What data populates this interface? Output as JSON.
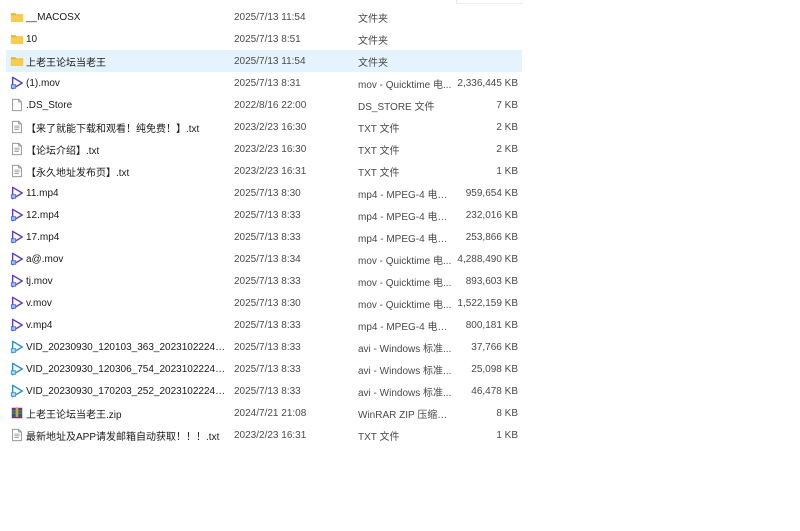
{
  "files": [
    {
      "name": "__MACOSX",
      "date": "2025/7/13 11:54",
      "type": "文件夹",
      "size": "",
      "icon": "folder-icon"
    },
    {
      "name": "10",
      "date": "2025/7/13 8:51",
      "type": "文件夹",
      "size": "",
      "icon": "folder-icon"
    },
    {
      "name": "上老王论坛当老王",
      "date": "2025/7/13 11:54",
      "type": "文件夹",
      "size": "",
      "icon": "folder-icon",
      "selected": true
    },
    {
      "name": "(1).mov",
      "date": "2025/7/13 8:31",
      "type": "mov - Quicktime 电...",
      "size": "2,336,445 KB",
      "icon": "video-file-icon"
    },
    {
      "name": ".DS_Store",
      "date": "2022/8/16 22:00",
      "type": "DS_STORE 文件",
      "size": "7 KB",
      "icon": "blank-file-icon"
    },
    {
      "name": "【来了就能下载和观看！纯免费！】.txt",
      "date": "2023/2/23 16:30",
      "type": "TXT 文件",
      "size": "2 KB",
      "icon": "text-file-icon"
    },
    {
      "name": "【论坛介绍】.txt",
      "date": "2023/2/23 16:30",
      "type": "TXT 文件",
      "size": "2 KB",
      "icon": "text-file-icon"
    },
    {
      "name": "【永久地址发布页】.txt",
      "date": "2023/2/23 16:31",
      "type": "TXT 文件",
      "size": "1 KB",
      "icon": "text-file-icon"
    },
    {
      "name": "11.mp4",
      "date": "2025/7/13 8:30",
      "type": "mp4 - MPEG-4 电影...",
      "size": "959,654 KB",
      "icon": "video-file-icon"
    },
    {
      "name": "12.mp4",
      "date": "2025/7/13 8:33",
      "type": "mp4 - MPEG-4 电影...",
      "size": "232,016 KB",
      "icon": "video-file-icon"
    },
    {
      "name": "17.mp4",
      "date": "2025/7/13 8:33",
      "type": "mp4 - MPEG-4 电影...",
      "size": "253,866 KB",
      "icon": "video-file-icon"
    },
    {
      "name": "a@.mov",
      "date": "2025/7/13 8:34",
      "type": "mov - Quicktime 电...",
      "size": "4,288,490 KB",
      "icon": "video-file-icon"
    },
    {
      "name": "tj.mov",
      "date": "2025/7/13 8:33",
      "type": "mov - Quicktime 电...",
      "size": "893,603 KB",
      "icon": "video-file-icon"
    },
    {
      "name": "v.mov",
      "date": "2025/7/13 8:30",
      "type": "mov - Quicktime 电...",
      "size": "1,522,159 KB",
      "icon": "video-file-icon"
    },
    {
      "name": "v.mp4",
      "date": "2025/7/13 8:33",
      "type": "mp4 - MPEG-4 电影...",
      "size": "800,181 KB",
      "icon": "video-file-icon"
    },
    {
      "name": "VID_20230930_120103_363_20231022245...",
      "date": "2025/7/13 8:33",
      "type": "avi - Windows 标准...",
      "size": "37,766 KB",
      "icon": "avi-file-icon"
    },
    {
      "name": "VID_20230930_120306_754_20231022245...",
      "date": "2025/7/13 8:33",
      "type": "avi - Windows 标准...",
      "size": "25,098 KB",
      "icon": "avi-file-icon"
    },
    {
      "name": "VID_20230930_170203_252_20231022248...",
      "date": "2025/7/13 8:33",
      "type": "avi - Windows 标准...",
      "size": "46,478 KB",
      "icon": "avi-file-icon"
    },
    {
      "name": "上老王论坛当老王.zip",
      "date": "2024/7/21 21:08",
      "type": "WinRAR ZIP 压缩文件",
      "size": "8 KB",
      "icon": "winrar-archive-icon"
    },
    {
      "name": "最新地址及APP请发邮箱自动获取！！！.txt",
      "date": "2023/2/23 16:31",
      "type": "TXT 文件",
      "size": "1 KB",
      "icon": "text-file-icon"
    }
  ],
  "colors": {
    "folder": "#f4c542",
    "selected_row": "#e5f3ff",
    "video": "#5b3cc4"
  }
}
